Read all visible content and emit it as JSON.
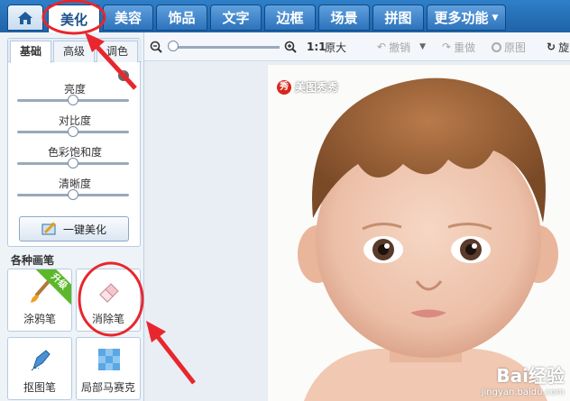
{
  "top_tabs": [
    {
      "label": "美化",
      "active": true
    },
    {
      "label": "美容"
    },
    {
      "label": "饰品"
    },
    {
      "label": "文字"
    },
    {
      "label": "边框"
    },
    {
      "label": "场景"
    },
    {
      "label": "拼图"
    },
    {
      "label": "更多功能"
    }
  ],
  "left_panel": {
    "sub_tabs": [
      "基础",
      "高级",
      "调色"
    ],
    "sliders": [
      {
        "label": "亮度",
        "value": 0.5
      },
      {
        "label": "对比度",
        "value": 0.5
      },
      {
        "label": "色彩饱和度",
        "value": 0.5
      },
      {
        "label": "清晰度",
        "value": 0.5
      }
    ],
    "onekey_label": "一键美化",
    "brushes_title": "各种画笔",
    "brushes": [
      {
        "label": "涂鸦笔",
        "badge": "升级"
      },
      {
        "label": "消除笔"
      },
      {
        "label": "抠图笔"
      },
      {
        "label": "局部马赛克"
      }
    ]
  },
  "toolbar": {
    "zoom_level": 0,
    "ratio_label": "1:1",
    "original_size_label": "原大",
    "undo_label": "撤销",
    "redo_label": "重做",
    "original_label": "原图",
    "rotate_label": "旋"
  },
  "canvas": {
    "watermark_seal": "秀",
    "watermark_text": "美图秀秀",
    "baidu_line1": "Bai经验",
    "baidu_line2": "jingyan.baidu.com"
  },
  "colors": {
    "accent": "#1f63a8",
    "annotation": "#e8262d",
    "badge": "#5cb82a"
  }
}
